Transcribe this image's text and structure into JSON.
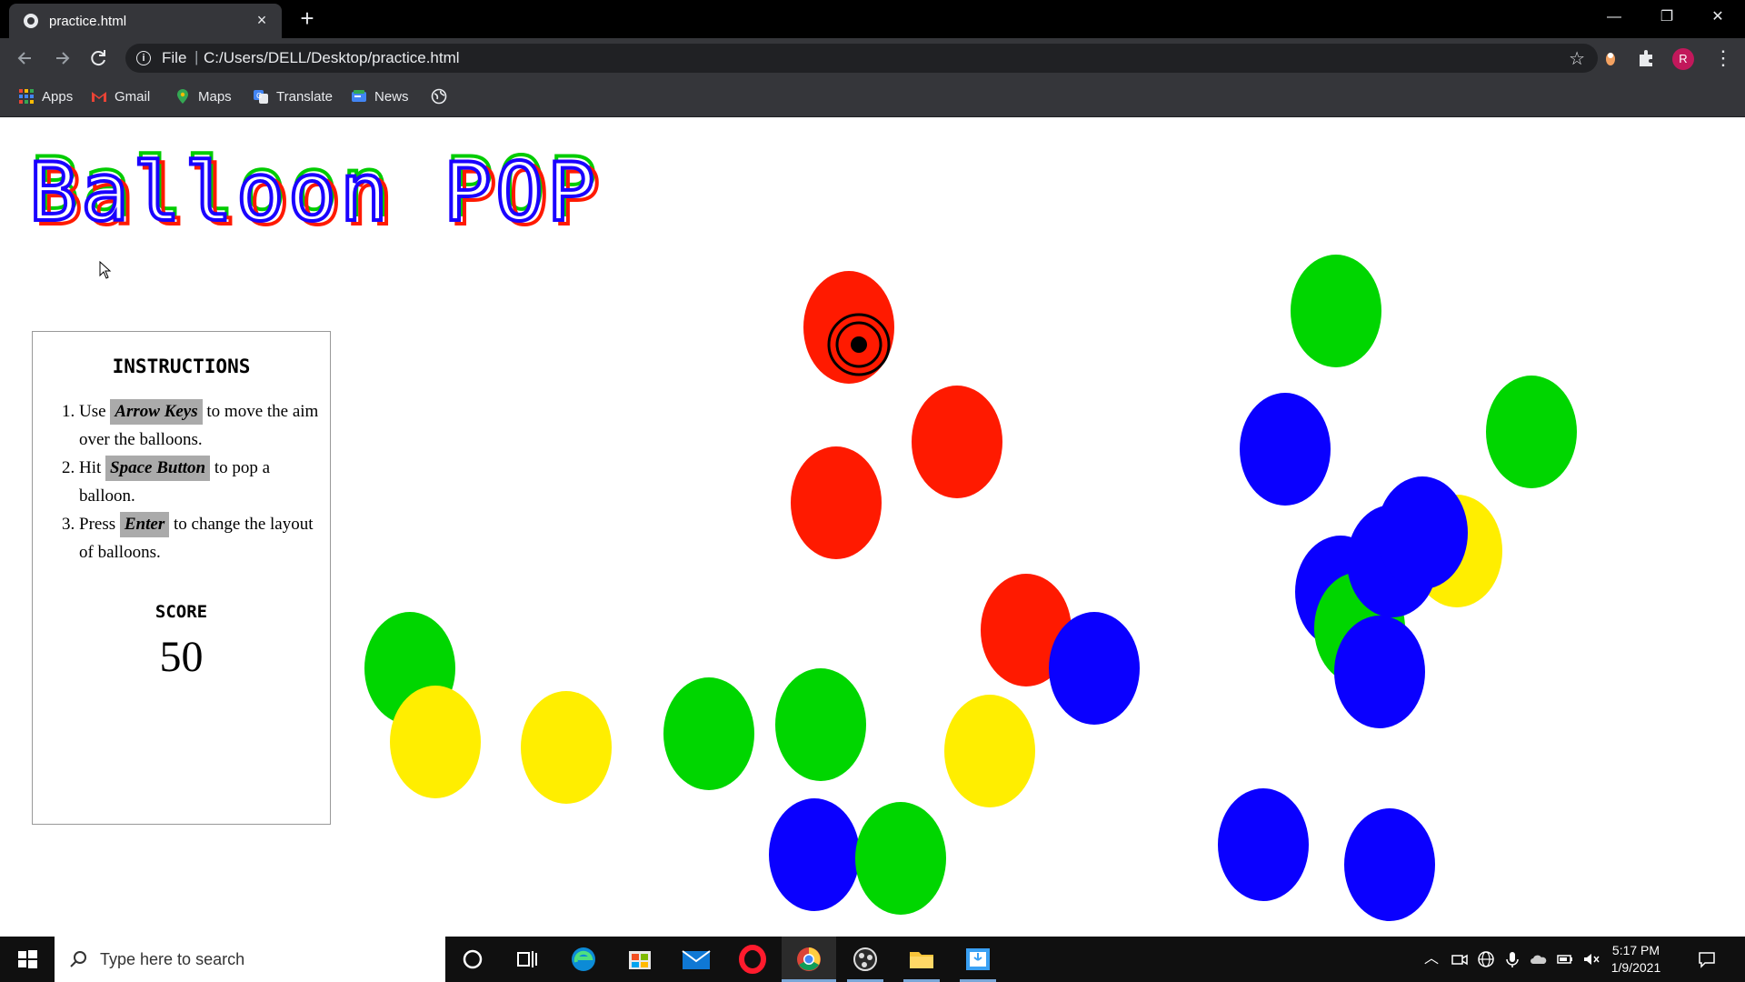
{
  "browser": {
    "tab_title": "practice.html",
    "new_tab_symbol": "+",
    "close_tab_symbol": "×",
    "address_scheme": "File",
    "address_url": "C:/Users/DELL/Desktop/practice.html",
    "profile_initial": "R",
    "window_controls": {
      "minimize": "—",
      "restore": "❐",
      "close": "✕"
    }
  },
  "bookmarks": [
    {
      "label": "Apps",
      "icon": "apps-grid-icon"
    },
    {
      "label": "Gmail",
      "icon": "gmail-icon"
    },
    {
      "label": "Maps",
      "icon": "maps-pin-icon"
    },
    {
      "label": "Translate",
      "icon": "translate-icon"
    },
    {
      "label": "News",
      "icon": "news-icon"
    },
    {
      "label": "",
      "icon": "globe-icon"
    }
  ],
  "game": {
    "title": "Balloon POP",
    "instructions_heading": "INSTRUCTIONS",
    "instructions": [
      {
        "before": "Use ",
        "key": "Arrow Keys",
        "after": " to move the aim over the balloons."
      },
      {
        "before": "Hit ",
        "key": "Space Button",
        "after": " to pop a balloon."
      },
      {
        "before": "Press ",
        "key": "Enter",
        "after": " to change the layout of balloons."
      }
    ],
    "score_label": "SCORE",
    "score_value": "50",
    "balloon_colors": {
      "red": "#ff1a00",
      "green": "#00d600",
      "blue": "#0a00ff",
      "yellow": "#ffee00"
    },
    "balloons": [
      {
        "color": "red"
      },
      {
        "color": "red"
      },
      {
        "color": "red"
      },
      {
        "color": "red"
      },
      {
        "color": "green"
      },
      {
        "color": "green"
      },
      {
        "color": "green"
      },
      {
        "color": "green"
      },
      {
        "color": "green"
      },
      {
        "color": "green"
      },
      {
        "color": "green"
      },
      {
        "color": "blue"
      },
      {
        "color": "blue"
      },
      {
        "color": "blue"
      },
      {
        "color": "blue"
      },
      {
        "color": "blue"
      },
      {
        "color": "blue"
      },
      {
        "color": "blue"
      },
      {
        "color": "blue"
      },
      {
        "color": "blue"
      },
      {
        "color": "yellow"
      },
      {
        "color": "yellow"
      },
      {
        "color": "yellow"
      },
      {
        "color": "yellow"
      }
    ]
  },
  "taskbar": {
    "search_placeholder": "Type here to search",
    "apps": [
      "cortana-icon",
      "task-view-icon",
      "edge-icon",
      "store-icon",
      "mail-icon",
      "opera-icon",
      "chrome-icon",
      "obs-icon",
      "file-explorer-icon",
      "app-icon"
    ],
    "time": "5:17 PM",
    "date": "1/9/2021"
  }
}
